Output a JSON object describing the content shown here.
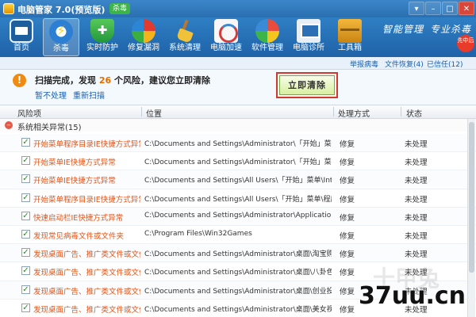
{
  "window": {
    "title": "电脑管家 7.0(预览版)",
    "badge": "杀毒",
    "controls": [
      "▾",
      "–",
      "□",
      "✕"
    ]
  },
  "toolbar": {
    "items": [
      {
        "label": "首页",
        "icon": "home-icon"
      },
      {
        "label": "杀毒",
        "icon": "antivirus-icon"
      },
      {
        "label": "实时防护",
        "icon": "shield-icon"
      },
      {
        "label": "修复漏洞",
        "icon": "patch-icon"
      },
      {
        "label": "系统清理",
        "icon": "broom-icon"
      },
      {
        "label": "电脑加速",
        "icon": "speedometer-icon"
      },
      {
        "label": "软件管理",
        "icon": "software-icon"
      },
      {
        "label": "电脑诊所",
        "icon": "clinic-icon"
      },
      {
        "label": "工具箱",
        "icon": "toolbox-icon"
      }
    ],
    "slogan_1": "智能管理",
    "slogan_2": "专业杀毒",
    "corner_badge": "先中后",
    "active_index": 1
  },
  "sublinks": {
    "report": "举报病毒",
    "recovery": "文件恢复(4)",
    "trusted": "已信任(12)"
  },
  "result": {
    "prefix": "扫描完成，发现",
    "count": "26",
    "suffix": "个风险，建议您立即清除",
    "ignore_link": "暂不处理",
    "rescan_link": "重新扫描",
    "clean_button": "立即清除"
  },
  "table": {
    "headers": {
      "risk": "风险项",
      "path": "位置",
      "mode": "处理方式",
      "status": "状态"
    },
    "group": "系统相关异常(15)",
    "rows": [
      {
        "risk": "开始菜单程序目录IE快捷方式异常",
        "path": "C:\\Documents and Settings\\Administrator\\「开始」菜单\\程序\\I...",
        "mode": "修复",
        "status": "未处理"
      },
      {
        "risk": "开始菜单IE快捷方式异常",
        "path": "C:\\Documents and Settings\\Administrator\\「开始」菜单\\Intern...",
        "mode": "修复",
        "status": "未处理"
      },
      {
        "risk": "开始菜单IE快捷方式异常",
        "path": "C:\\Documents and Settings\\All Users\\「开始」菜单\\Internet Ex...",
        "mode": "修复",
        "status": "未处理"
      },
      {
        "risk": "开始菜单程序目录IE快捷方式异常",
        "path": "C:\\Documents and Settings\\All Users\\「开始」菜单\\程序\\Inter...",
        "mode": "修复",
        "status": "未处理"
      },
      {
        "risk": "快速启动栏IE快捷方式异常",
        "path": "C:\\Documents and Settings\\Administrator\\Application Data\\Micro...",
        "mode": "修复",
        "status": "未处理"
      },
      {
        "risk": "发现常见病毒文件或文件夹",
        "path": "C:\\Program Files\\Win32Games",
        "mode": "修复",
        "status": "未处理"
      },
      {
        "risk": "发现桌面广告、推广类文件或文件夹",
        "path": "C:\\Documents and Settings\\Administrator\\桌面\\淘宝购物.exe",
        "mode": "修复",
        "status": "未处理"
      },
      {
        "risk": "发现桌面广告、推广类文件或文件夹",
        "path": "C:\\Documents and Settings\\Administrator\\桌面\\八卦色图.exe",
        "mode": "修复",
        "status": "未处理"
      },
      {
        "risk": "发现桌面广告、推广类文件或文件夹",
        "path": "C:\\Documents and Settings\\Administrator\\桌面\\创业投资好项...",
        "mode": "修复",
        "status": "未处理"
      },
      {
        "risk": "发现桌面广告、推广类文件或文件夹",
        "path": "C:\\Documents and Settings\\Administrator\\桌面\\美女视频.exe",
        "mode": "修复",
        "status": "未处理"
      }
    ]
  },
  "watermark": "37uu.cn",
  "watermark_faint": "十甲兔",
  "colors": {
    "titlebar": "#2a6fb0",
    "toolbar": "#1f62a8",
    "risk_text": "#e2551a",
    "highlight_border": "#d2382e",
    "warning": "#ef8a12"
  }
}
